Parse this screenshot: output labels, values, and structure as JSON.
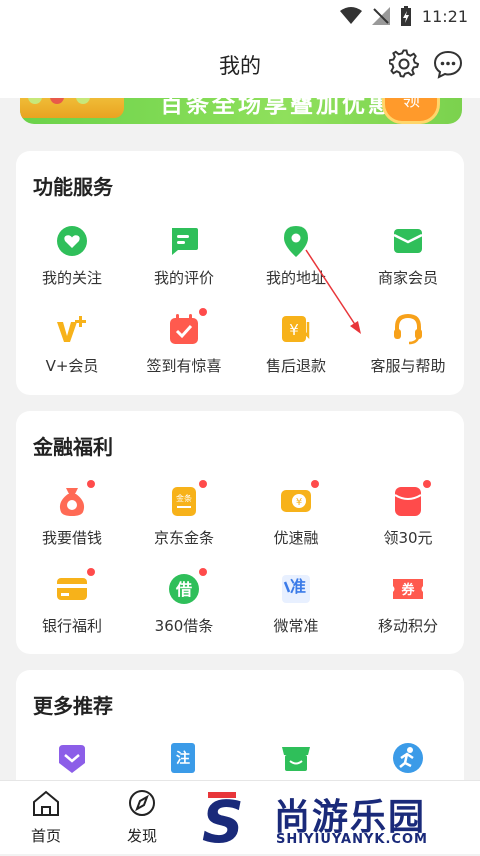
{
  "status_bar": {
    "time": "11:21"
  },
  "header": {
    "title": "我的"
  },
  "banner": {
    "text": "百条全场享叠加优惠",
    "button": "领"
  },
  "services": {
    "title": "功能服务",
    "items": [
      {
        "label": "我的关注",
        "icon": "heart-icon",
        "color": "#2fbf5a"
      },
      {
        "label": "我的评价",
        "icon": "comment-icon",
        "color": "#2fbf5a"
      },
      {
        "label": "我的地址",
        "icon": "location-pin-icon",
        "color": "#2fbf5a"
      },
      {
        "label": "商家会员",
        "icon": "wallet-icon",
        "color": "#2fbf5a"
      },
      {
        "label": "V+会员",
        "icon": "vplus-icon",
        "color": "#f7b21a"
      },
      {
        "label": "签到有惊喜",
        "icon": "calendar-check-icon",
        "color": "#ff5a4e"
      },
      {
        "label": "售后退款",
        "icon": "refund-icon",
        "color": "#f7b21a"
      },
      {
        "label": "客服与帮助",
        "icon": "headset-icon",
        "color": "#f7a11a"
      }
    ]
  },
  "finance": {
    "title": "金融福利",
    "items": [
      {
        "label": "我要借钱",
        "icon": "money-bag-icon",
        "color": "#ff6a55"
      },
      {
        "label": "京东金条",
        "icon": "gold-bar-icon",
        "color": "#f7b21a",
        "glyph": "金条"
      },
      {
        "label": "优速融",
        "icon": "wallet-coin-icon",
        "color": "#f7b21a",
        "glyph": "¥"
      },
      {
        "label": "领30元",
        "icon": "red-packet-icon",
        "color": "#ff4b4b"
      },
      {
        "label": "银行福利",
        "icon": "bank-card-icon",
        "color": "#f7b21a"
      },
      {
        "label": "360借条",
        "icon": "jie-icon",
        "color": "#2fbf5a",
        "glyph": "借"
      },
      {
        "label": "微常准",
        "icon": "zhun-icon",
        "color": "#3b7be8",
        "glyph": "准"
      },
      {
        "label": "移动积分",
        "icon": "coupon-icon",
        "color": "#ff5a4e",
        "glyph": "券"
      }
    ]
  },
  "more": {
    "title": "更多推荐",
    "items": [
      {
        "icon": "gem-icon",
        "color": "#8c5ee8"
      },
      {
        "icon": "register-icon",
        "color": "#3b9be8",
        "glyph": "注"
      },
      {
        "icon": "store-icon",
        "color": "#2fbf5a"
      },
      {
        "icon": "runner-icon",
        "color": "#3b9be8"
      }
    ]
  },
  "bottom_nav": [
    {
      "label": "首页",
      "icon": "home-icon"
    },
    {
      "label": "发现",
      "icon": "compass-icon"
    }
  ],
  "watermark": {
    "title": "尚游乐园",
    "subtitle": "SHIYIUYANYK.COM",
    "letter": "S"
  }
}
